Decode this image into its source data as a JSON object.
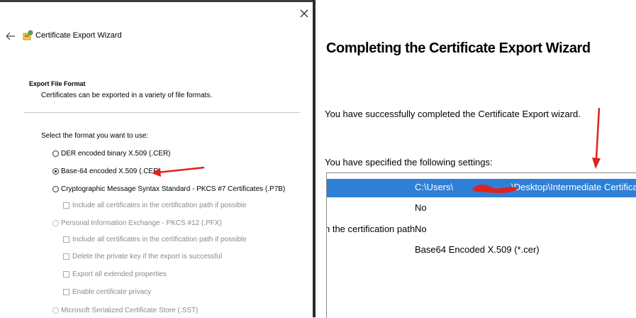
{
  "left": {
    "wizard_title": "Certificate Export Wizard",
    "section_title": "Export File Format",
    "section_desc": "Certificates can be exported in a variety of file formats.",
    "prompt": "Select the format you want to use:",
    "options": [
      {
        "label": "DER encoded binary X.509 (.CER)",
        "checked": false,
        "disabled": false
      },
      {
        "label": "Base-64 encoded X.509 (.CER)",
        "checked": true,
        "disabled": false
      },
      {
        "label": "Cryptographic Message Syntax Standard - PKCS #7 Certificates (.P7B)",
        "checked": false,
        "disabled": false
      },
      {
        "label": "Include all certificates in the certification path if possible",
        "checked": false,
        "disabled": true
      },
      {
        "label": "Personal Information Exchange - PKCS #12 (.PFX)",
        "checked": false,
        "disabled": true
      },
      {
        "label": "Include all certificates in the certification path if possible",
        "checked": false,
        "disabled": true
      },
      {
        "label": "Delete the private key if the export is successful",
        "checked": false,
        "disabled": true
      },
      {
        "label": "Export all extended properties",
        "checked": false,
        "disabled": true
      },
      {
        "label": "Enable certificate privacy",
        "checked": false,
        "disabled": true
      },
      {
        "label": "Microsoft Serialized Certificate Store (.SST)",
        "checked": false,
        "disabled": true
      }
    ]
  },
  "right": {
    "title": "Completing the Certificate Export Wizard",
    "success_msg": "You have successfully completed the Certificate Export wizard.",
    "settings_label": "You have specified the following settings:",
    "settings": [
      {
        "key": "",
        "value_prefix": "C:\\Users\\",
        "value_suffix": "\\Desktop\\Intermediate Certificate.cer",
        "selected": true
      },
      {
        "key": "",
        "value": "No",
        "selected": false
      },
      {
        "key": "n the certification path",
        "value": "No",
        "selected": false
      },
      {
        "key": "",
        "value": "Base64 Encoded X.509 (*.cer)",
        "selected": false
      }
    ]
  },
  "colors": {
    "selection": "#2f7fd6",
    "annotation_red": "#e0211d"
  },
  "icons": [
    "close-icon",
    "back-arrow-icon",
    "certificate-wizard-icon"
  ]
}
